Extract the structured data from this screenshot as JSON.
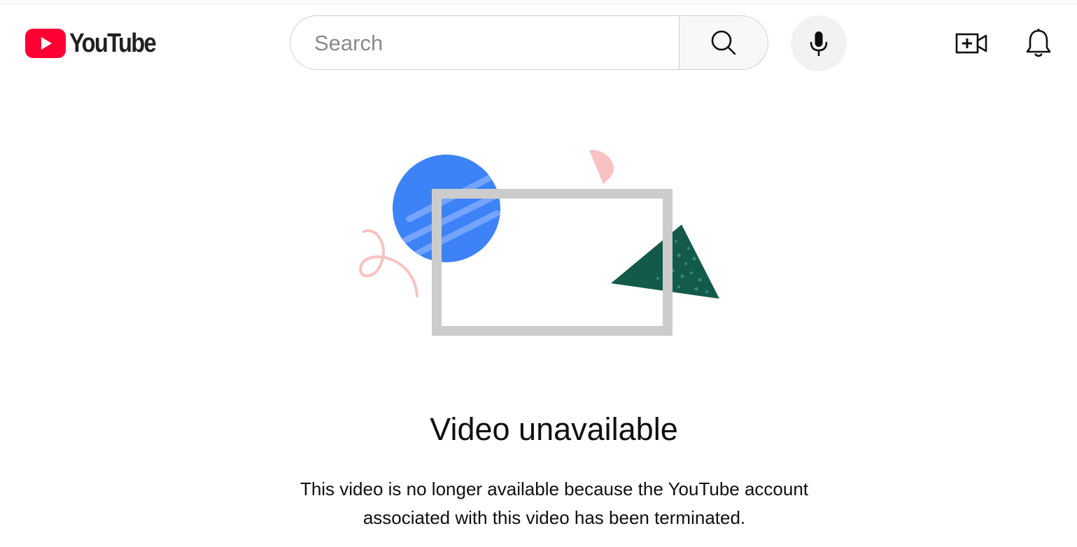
{
  "header": {
    "logo_text": "YouTube",
    "search": {
      "placeholder": "Search",
      "value": ""
    },
    "icons": {
      "search": "search-icon",
      "mic": "microphone-icon",
      "create": "video-plus-icon",
      "notifications": "bell-icon"
    }
  },
  "error": {
    "title": "Video unavailable",
    "message": "This video is no longer available because the YouTube account associated with this video has been terminated."
  },
  "colors": {
    "brand_red": "#ff0033",
    "circle_blue": "#3d82f7",
    "triangle_green": "#145a4a",
    "accent_pink": "#f8c2c2",
    "frame_gray": "#cccccc"
  }
}
